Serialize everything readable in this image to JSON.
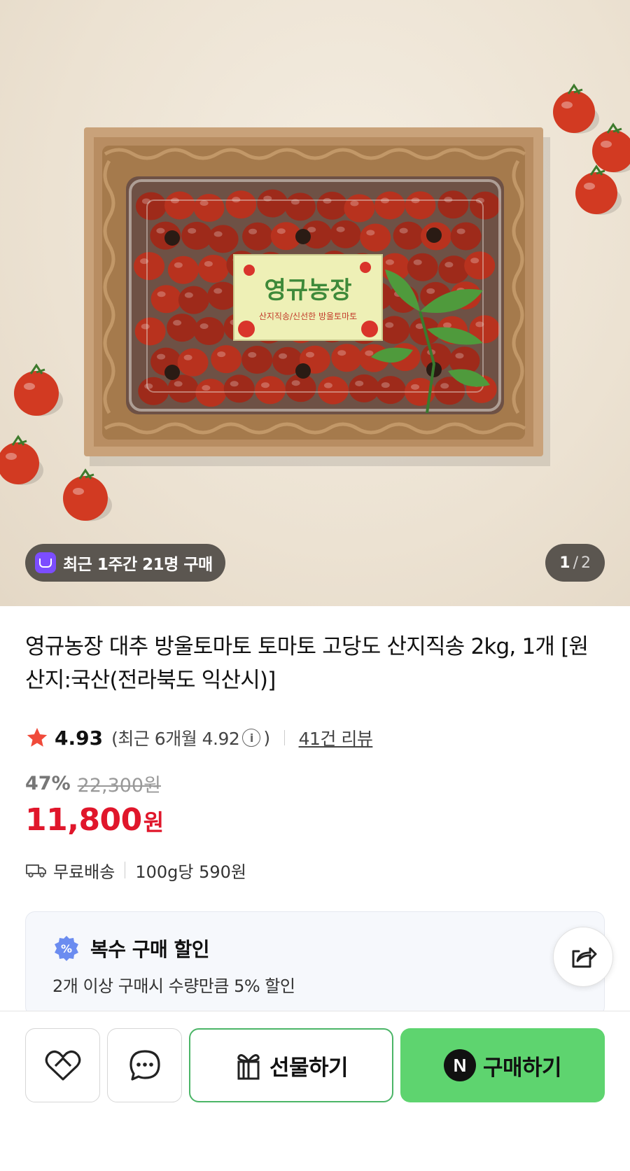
{
  "hero": {
    "label_title": "영규농장",
    "label_subtitle": "산지직송/신선한 방울토마토",
    "purchase_badge": "최근 1주간 21명 구매",
    "pager_current": "1",
    "pager_separator": "/",
    "pager_total": "2"
  },
  "product": {
    "title": "영규농장 대추 방울토마토 토마토 고당도 산지직송 2kg, 1개 [원산지:국산(전라북도 익산시)]",
    "rating": "4.93",
    "recent_prefix": "(최근 6개월 4.92",
    "recent_suffix": ")",
    "info_symbol": "i",
    "review_link": "41건 리뷰",
    "discount": "47%",
    "original_price": "22,300원",
    "price": "11,800",
    "price_unit": "원",
    "shipping": "무료배송",
    "unit_price": "100g당 590원"
  },
  "promo": {
    "icon_symbol": "%",
    "title": "복수 구매 할인",
    "description": "2개 이상 구매시 수량만큼 5% 할인"
  },
  "bottom_bar": {
    "gift_label": "선물하기",
    "buy_label": "구매하기",
    "buy_logo": "N"
  },
  "colors": {
    "price_red": "#e0162b",
    "buy_green": "#5ed46f",
    "gift_border": "#4bb567",
    "star": "#f04a3a",
    "promo_icon": "#6b8cf0"
  },
  "icons": [
    "basket-icon",
    "star-icon",
    "info-icon",
    "truck-icon",
    "percent-icon",
    "share-icon",
    "heart-icon",
    "chat-icon",
    "gift-icon",
    "naver-n-icon"
  ]
}
